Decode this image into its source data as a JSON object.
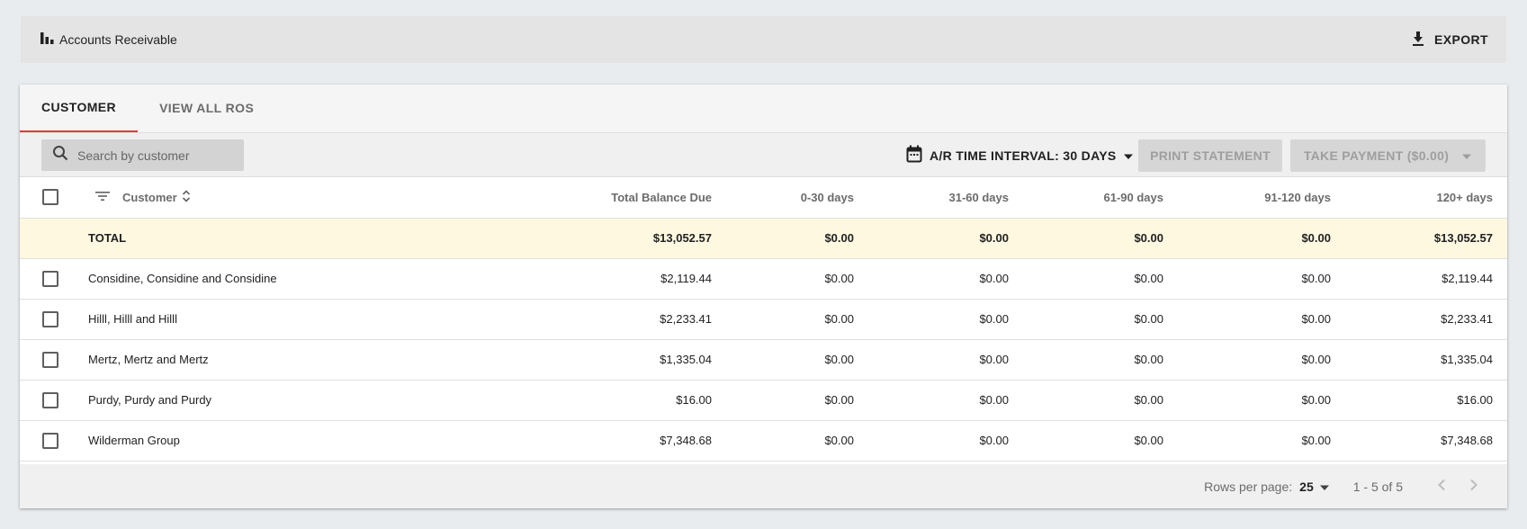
{
  "header": {
    "title": "Accounts Receivable",
    "export_label": "EXPORT"
  },
  "tabs": [
    {
      "label": "CUSTOMER",
      "active": true
    },
    {
      "label": "VIEW ALL ROS",
      "active": false
    }
  ],
  "toolbar": {
    "search_placeholder": "Search by customer",
    "search_value": "",
    "interval_label": "A/R TIME INTERVAL: 30 DAYS",
    "print_label": "PRINT STATEMENT",
    "take_payment_label": "TAKE PAYMENT ($0.00)"
  },
  "table": {
    "columns": [
      "Customer",
      "Total Balance Due",
      "0-30 days",
      "31-60 days",
      "61-90 days",
      "91-120 days",
      "120+ days"
    ],
    "total": {
      "label": "TOTAL",
      "values": [
        "$13,052.57",
        "$0.00",
        "$0.00",
        "$0.00",
        "$0.00",
        "$13,052.57"
      ]
    },
    "rows": [
      {
        "name": "Considine, Considine and Considine",
        "values": [
          "$2,119.44",
          "$0.00",
          "$0.00",
          "$0.00",
          "$0.00",
          "$2,119.44"
        ]
      },
      {
        "name": "Hilll, Hilll and Hilll",
        "values": [
          "$2,233.41",
          "$0.00",
          "$0.00",
          "$0.00",
          "$0.00",
          "$2,233.41"
        ]
      },
      {
        "name": "Mertz, Mertz and Mertz",
        "values": [
          "$1,335.04",
          "$0.00",
          "$0.00",
          "$0.00",
          "$0.00",
          "$1,335.04"
        ]
      },
      {
        "name": "Purdy, Purdy and Purdy",
        "values": [
          "$16.00",
          "$0.00",
          "$0.00",
          "$0.00",
          "$0.00",
          "$16.00"
        ]
      },
      {
        "name": "Wilderman Group",
        "values": [
          "$7,348.68",
          "$0.00",
          "$0.00",
          "$0.00",
          "$0.00",
          "$7,348.68"
        ]
      }
    ]
  },
  "footer": {
    "rows_per_page_label": "Rows per page:",
    "rows_per_page_value": "25",
    "range_label": "1 - 5 of 5"
  },
  "icons": {
    "chart": "bar-chart-icon",
    "export": "download-icon",
    "search": "search-icon",
    "calendar": "calendar-icon",
    "filter": "filter-icon",
    "sort": "sort-icon",
    "dropdown": "arrow-drop-down-icon",
    "prev": "chevron-left-icon",
    "next": "chevron-right-icon"
  },
  "colors": {
    "tab_indicator": "#e53935",
    "total_row_bg": "#fff8e1",
    "page_bg": "#e9ecef"
  }
}
